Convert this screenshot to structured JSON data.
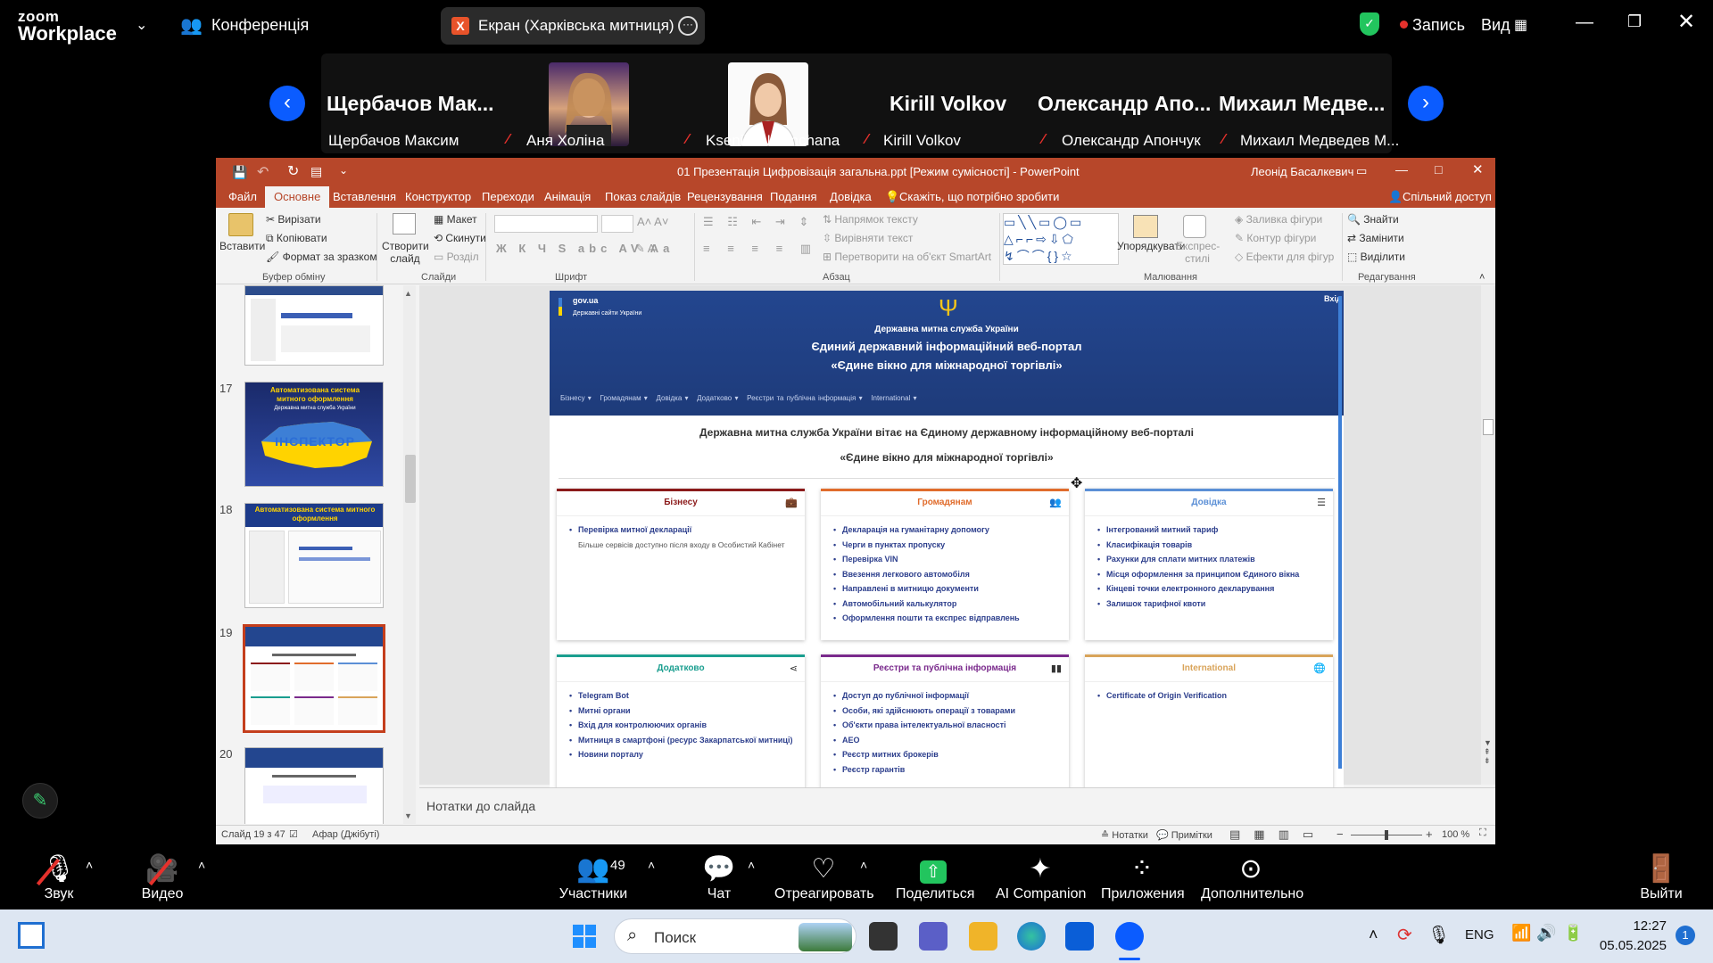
{
  "zoom": {
    "logo_top": "zoom",
    "logo_bottom": "Workplace",
    "meeting_label": "Конференція",
    "share_title": "Екран (Харківська митниця)",
    "record_label": "Запись",
    "view_label": "Вид"
  },
  "participants": {
    "big_names": [
      "Щербачов Мак...",
      "Kirill Volkov",
      "Олександр Апо...",
      "Михаил Медве..."
    ],
    "small_names": [
      "Щербачов Максим",
      "Аня Холіна",
      "Kseniia Nevinchana",
      "Kirill Volkov",
      "Олександр Апончук",
      "Михаил Медведев М..."
    ]
  },
  "ppt": {
    "title": "01 Презентація Цифровізація загальна.ppt [Режим сумісності] - PowerPoint",
    "user": "Леонід Басалкевич",
    "tabs": [
      "Файл",
      "Основне",
      "Вставлення",
      "Конструктор",
      "Переходи",
      "Анімація",
      "Показ слайдів",
      "Рецензування",
      "Подання",
      "Довідка"
    ],
    "tell_me": "Скажіть, що потрібно зробити",
    "share": "Спільний доступ",
    "ribbon": {
      "paste": "Вставити",
      "cut": "Вирізати",
      "copy": "Копіювати",
      "format_painter": "Формат за зразком",
      "clipboard": "Буфер обміну",
      "new_slide": "Створити слайд",
      "layout": "Макет",
      "reset": "Скинути",
      "section": "Розділ",
      "slides": "Слайди",
      "font": "Шрифт",
      "text_direction": "Напрямок тексту",
      "align_text": "Вирівняти текст",
      "smartart": "Перетворити на об'єкт SmartArt",
      "paragraph": "Абзац",
      "arrange": "Упорядкувати",
      "quick_styles": "Експрес-стилі",
      "shape_fill": "Заливка фігури",
      "shape_outline": "Контур фігури",
      "shape_effects": "Ефекти для фігур",
      "drawing": "Малювання",
      "find": "Знайти",
      "replace": "Замінити",
      "select": "Виділити",
      "editing": "Редагування"
    },
    "slide_numbers": [
      "17",
      "18",
      "19",
      "20"
    ],
    "thumb17": {
      "line1": "Автоматизована система",
      "line2": "митного оформлення",
      "line3": "Державна митна служба України",
      "line4": "ІНСПЕКТОР"
    },
    "thumb18": {
      "line1": "Автоматизована система митного",
      "line2": "оформлення"
    },
    "notes_placeholder": "Нотатки до слайда",
    "status": {
      "slide_info": "Слайд 19 з 47",
      "language": "Афар (Джібуті)",
      "notes": "Нотатки",
      "comments": "Примітки",
      "zoom": "100 %"
    }
  },
  "slide": {
    "gov_logo": "gov.ua",
    "gov_sub": "Державні сайти України",
    "login": "Вхід",
    "org": "Державна митна служба України",
    "title1": "Єдиний державний інформаційний веб-портал",
    "title2": "«Єдине вікно для міжнародної торгівлі»",
    "nav": [
      "Бізнесу",
      "Громадянам",
      "Довідка",
      "Додатково",
      "Реєстри та публічна інформація",
      "International"
    ],
    "welcome1": "Державна митна служба України вітає на Єдиному державному інформаційному веб-порталі",
    "welcome2": "«Єдине вікно для міжнародної торгівлі»",
    "cards": [
      {
        "title": "Бізнесу",
        "color": "#8b1a1a",
        "items": [
          "Перевірка митної декларації"
        ],
        "note": "Більше сервісів доступно після входу в Особистий Кабінет"
      },
      {
        "title": "Громадянам",
        "color": "#e06c2c",
        "items": [
          "Декларація на гуманітарну допомогу",
          "Черги в пунктах пропуску",
          "Перевірка VIN",
          "Ввезення легкового автомобіля",
          "Направлені в митницю документи",
          "Автомобільний калькулятор",
          "Оформлення пошти та експрес відправлень"
        ]
      },
      {
        "title": "Довідка",
        "color": "#5b8fd6",
        "items": [
          "Інтегрований митний тариф",
          "Класифікація товарів",
          "Рахунки для сплати митних платежів",
          "Місця оформлення за принципом Єдиного вікна",
          "Кінцеві точки електронного декларування",
          "Залишок тарифної квоти"
        ]
      },
      {
        "title": "Додатково",
        "color": "#1a9e8f",
        "items": [
          "Telegram Bot",
          "Митні органи",
          "Вхід для контролюючих органів",
          "Митниця в смартфоні (ресурс Закарпатської митниці)",
          "Новини порталу"
        ]
      },
      {
        "title": "Реєстри та публічна інформація",
        "color": "#7a2a8c",
        "items": [
          "Доступ до публічної інформації",
          "Особи, які здійснюють операції з товарами",
          "Об'єкти права інтелектуальної власності",
          "AEO",
          "Реєстр митних брокерів",
          "Реєстр гарантів"
        ]
      },
      {
        "title": "International",
        "color": "#d9a45a",
        "items": [
          "Certificate of Origin Verification"
        ]
      }
    ]
  },
  "zoom_bar": {
    "audio": "Звук",
    "video": "Видео",
    "participants": "Участники",
    "participants_count": "49",
    "chat": "Чат",
    "react": "Отреагировать",
    "share": "Поделиться",
    "ai": "AI Companion",
    "apps": "Приложения",
    "more": "Дополнительно",
    "leave": "Выйти"
  },
  "taskbar": {
    "search": "Поиск",
    "lang": "ENG",
    "time": "12:27",
    "date": "05.05.2025",
    "notifications": "1"
  }
}
